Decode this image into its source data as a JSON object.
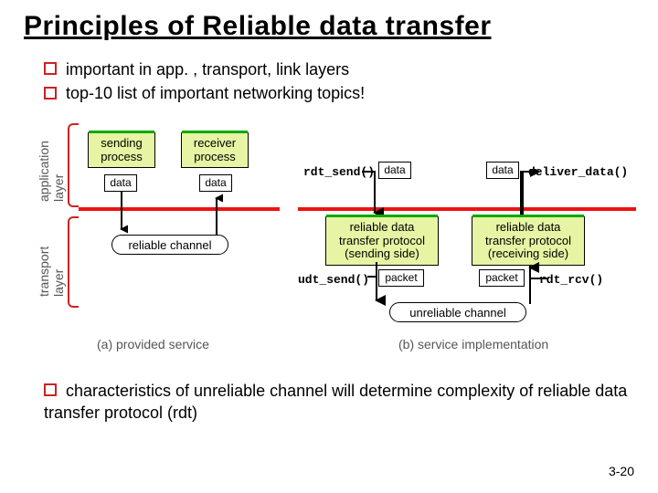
{
  "title": "Principles of Reliable data transfer",
  "bullets": [
    "important in app. , transport, link layers",
    "top-10 list of important networking topics!"
  ],
  "figure": {
    "layers": {
      "application": "application\nlayer",
      "transport": "transport\nlayer"
    },
    "left": {
      "sender": "sending\nprocess",
      "receiver": "receiver\nprocess",
      "channel": "reliable channel",
      "data1": "data",
      "data2": "data",
      "caption": "(a)     provided service"
    },
    "right": {
      "sender": "reliable data\ntransfer protocol\n(sending side)",
      "receiver": "reliable data\ntransfer protocol\n(receiving side)",
      "channel": "unreliable channel",
      "data1": "data",
      "data2": "data",
      "pkt1": "packet",
      "pkt2": "packet",
      "api": {
        "rdt_send": "rdt_send()",
        "deliver_data": "deliver_data()",
        "udt_send": "udt_send()",
        "rdt_rcv": "rdt_rcv()"
      },
      "caption": "(b)  service implementation"
    }
  },
  "bottom_bullet": "characteristics of unreliable channel will determine complexity of reliable data transfer protocol (rdt)",
  "slide_number": "3-20"
}
